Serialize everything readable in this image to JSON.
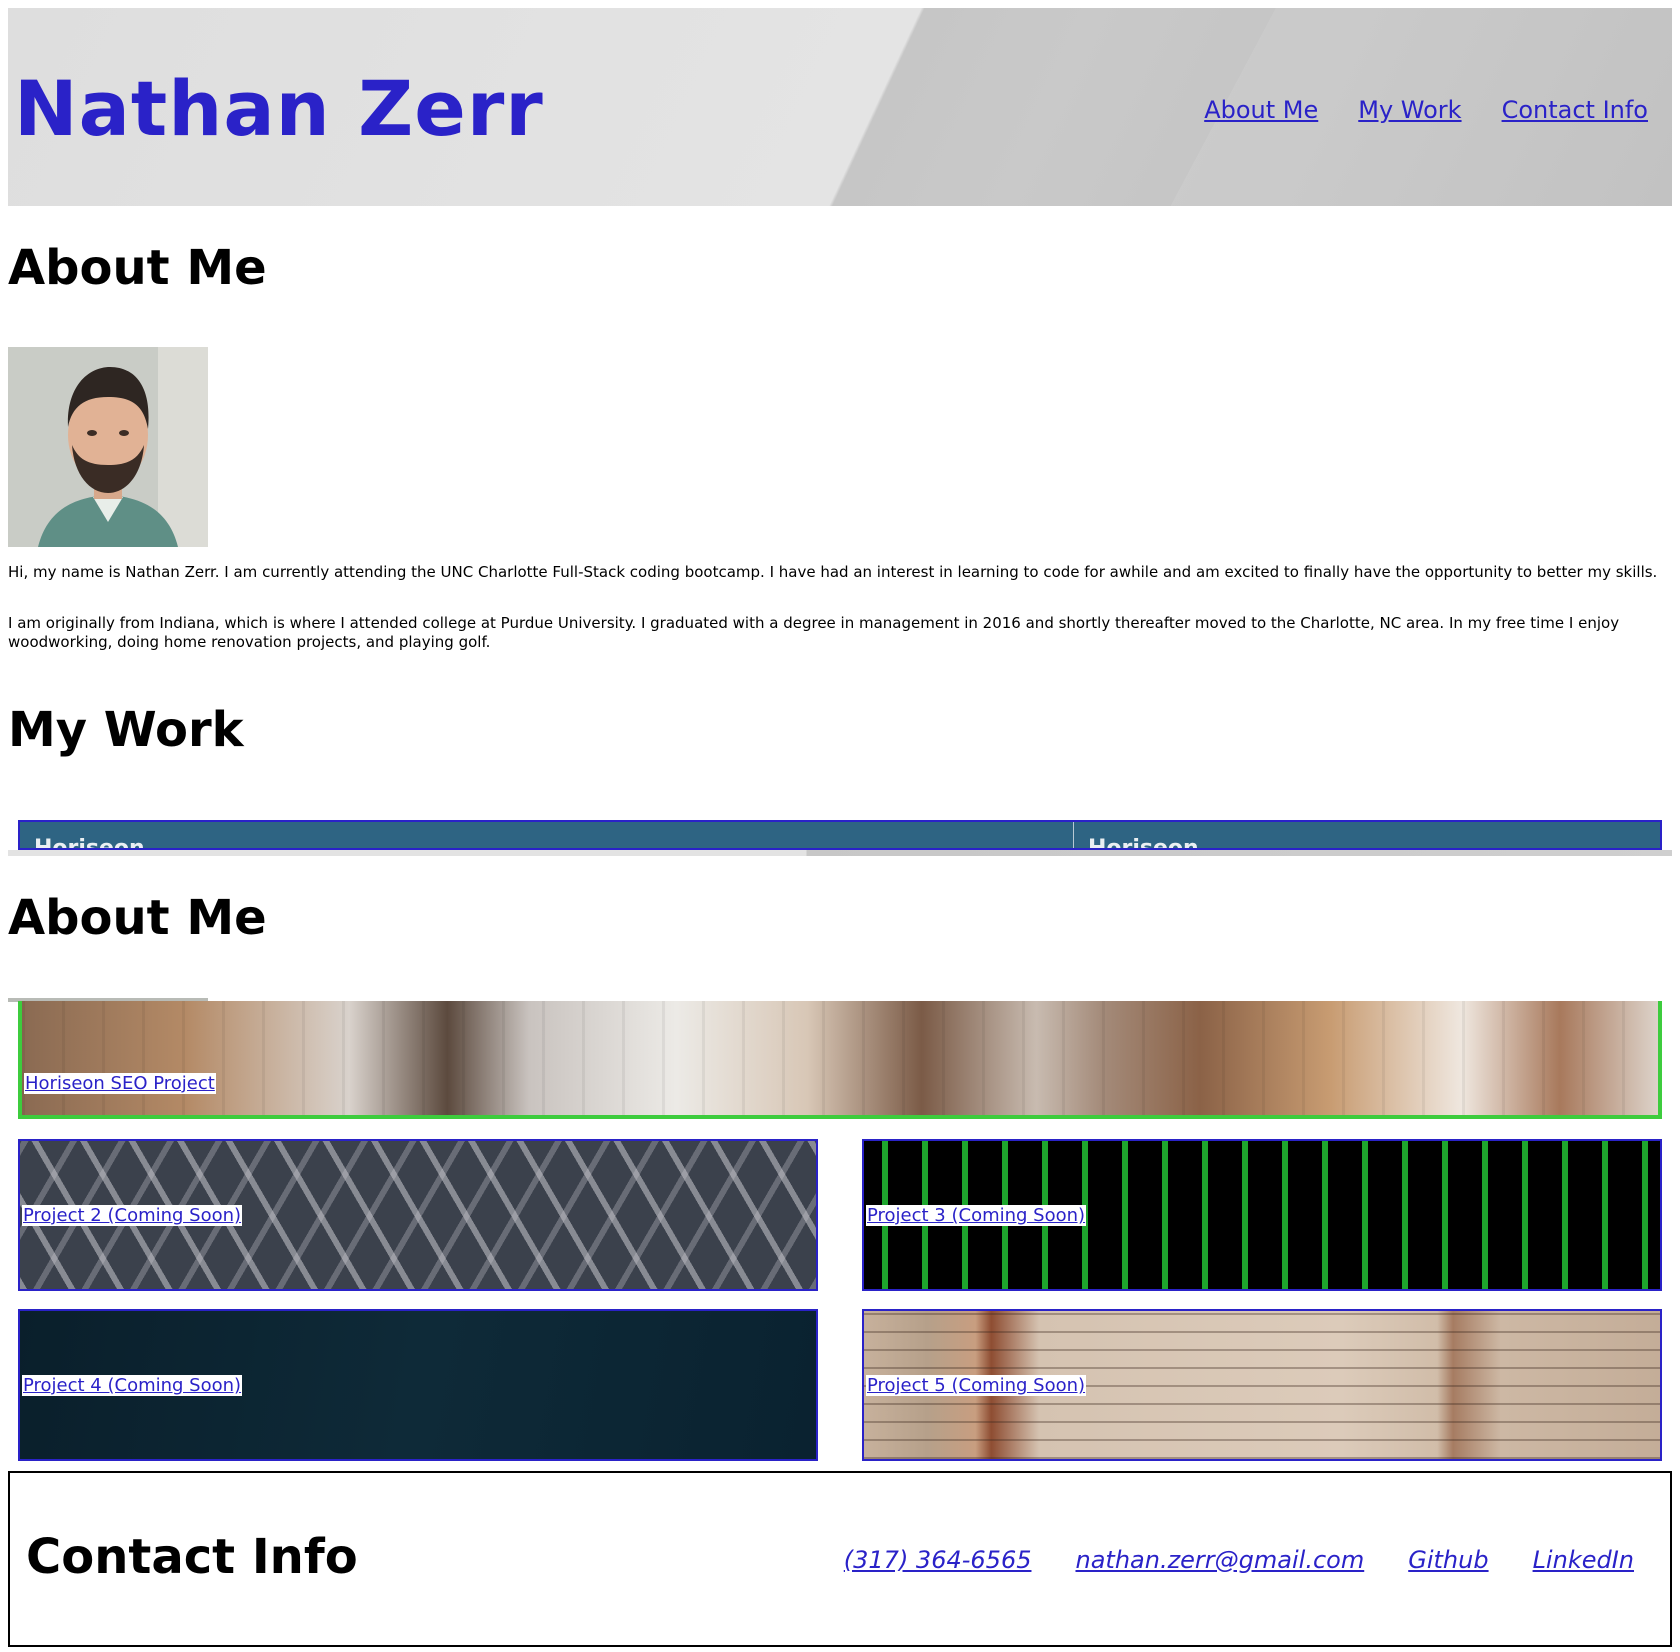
{
  "header": {
    "title": "Nathan Zerr",
    "nav": [
      "About Me",
      "My Work",
      "Contact Info"
    ]
  },
  "about": {
    "heading": "About Me",
    "heading_repeat": "About Me",
    "avatar_icon": "portrait-photo",
    "paragraphs": [
      "Hi, my name is Nathan Zerr. I am currently attending the UNC Charlotte Full-Stack coding bootcamp. I have had an interest in learning to code for awhile and am excited to finally have the opportunity to better my skills.",
      "I am originally from Indiana, which is where I attended college at Purdue University. I graduated with a degree in management in 2016 and shortly thereafter moved to the Charlotte, NC area. In my free time I enjoy woodworking, doing home renovation projects, and playing golf."
    ]
  },
  "work": {
    "heading": "My Work",
    "bar_labels": [
      "Horiseon",
      "Horiseon"
    ],
    "projects": [
      "Horiseon SEO Project",
      "Project 2 (Coming Soon)",
      "Project 3 (Coming Soon)",
      "Project 4 (Coming Soon)",
      "Project 5 (Coming Soon)"
    ]
  },
  "contact": {
    "heading": "Contact Info",
    "links": [
      "(317) 364-6565",
      "nathan.zerr@gmail.com",
      "Github",
      "LinkedIn"
    ]
  },
  "colors": {
    "link": "#2a22c8",
    "featured_border": "#3dcc3d",
    "work_bar": "#2e6483"
  }
}
